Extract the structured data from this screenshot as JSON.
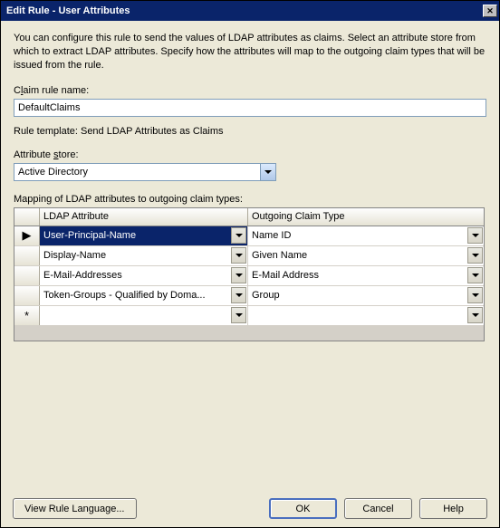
{
  "window": {
    "title": "Edit Rule - User Attributes"
  },
  "intro": "You can configure this rule to send the values of LDAP attributes as claims. Select an attribute store from which to extract LDAP attributes. Specify how the attributes will map to the outgoing claim types that will be issued from the rule.",
  "claimRuleName": {
    "label_pre": "C",
    "label_u": "l",
    "label_post": "aim rule name:",
    "value": "DefaultClaims"
  },
  "ruleTemplate": "Rule template: Send LDAP Attributes as Claims",
  "attributeStore": {
    "label_pre": "Attribute ",
    "label_u": "s",
    "label_post": "tore:",
    "selected": "Active Directory"
  },
  "mappingLabel": {
    "pre": "",
    "u": "M",
    "post": "apping of LDAP attributes to outgoing claim types:"
  },
  "grid": {
    "headers": {
      "ldap": "LDAP Attribute",
      "claim": "Outgoing Claim Type"
    },
    "rows": [
      {
        "marker": "▶",
        "ldap": "User-Principal-Name",
        "claim": "Name ID",
        "selected": true
      },
      {
        "marker": "",
        "ldap": "Display-Name",
        "claim": "Given Name"
      },
      {
        "marker": "",
        "ldap": "E-Mail-Addresses",
        "claim": "E-Mail Address"
      },
      {
        "marker": "",
        "ldap": "Token-Groups - Qualified by Doma...",
        "claim": "Group"
      },
      {
        "marker": "*",
        "ldap": "",
        "claim": ""
      }
    ]
  },
  "buttons": {
    "viewRule": "View Rule Language...",
    "ok": "OK",
    "cancel": "Cancel",
    "help": "Help"
  }
}
